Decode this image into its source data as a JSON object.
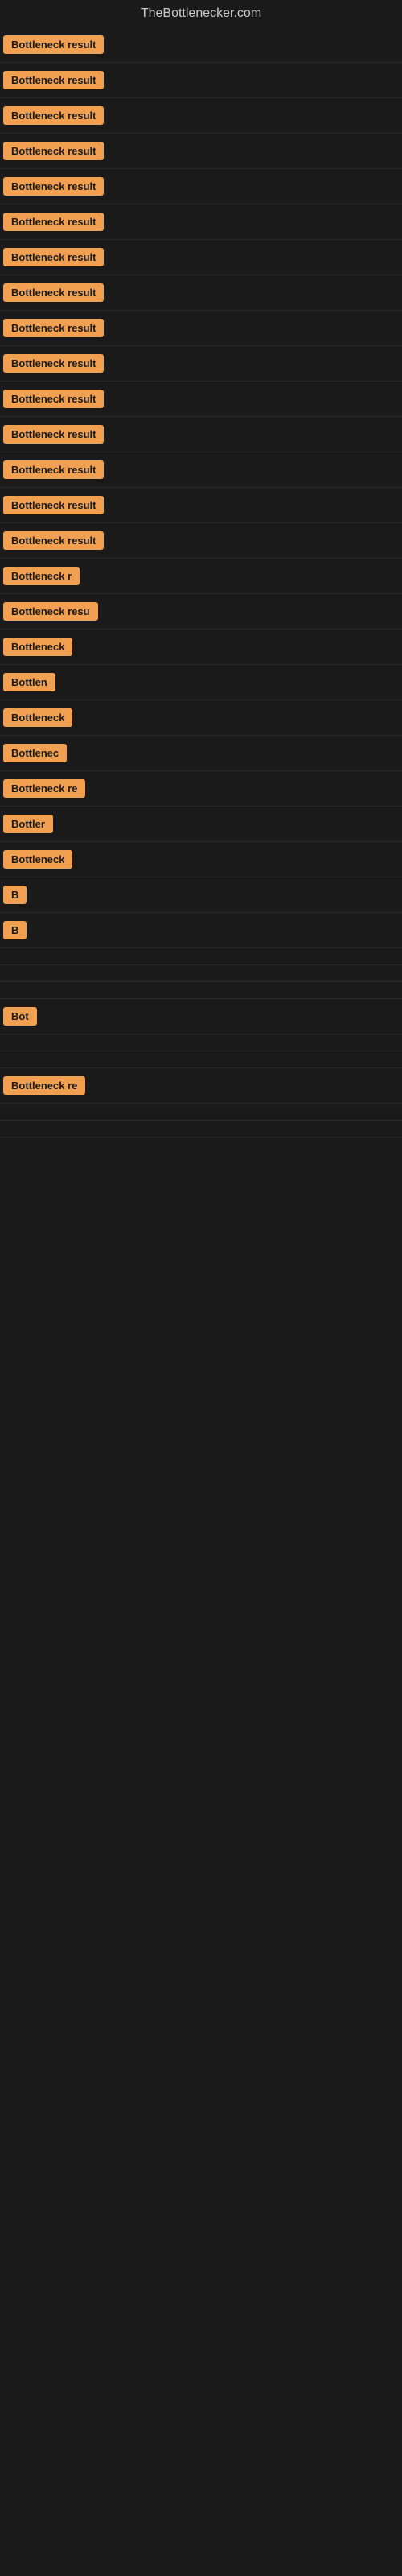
{
  "header": {
    "title": "TheBottlenecker.com"
  },
  "results": [
    {
      "label": "Bottleneck result",
      "width": 130
    },
    {
      "label": "Bottleneck result",
      "width": 130
    },
    {
      "label": "Bottleneck result",
      "width": 130
    },
    {
      "label": "Bottleneck result",
      "width": 130
    },
    {
      "label": "Bottleneck result",
      "width": 130
    },
    {
      "label": "Bottleneck result",
      "width": 130
    },
    {
      "label": "Bottleneck result",
      "width": 130
    },
    {
      "label": "Bottleneck result",
      "width": 130
    },
    {
      "label": "Bottleneck result",
      "width": 130
    },
    {
      "label": "Bottleneck result",
      "width": 130
    },
    {
      "label": "Bottleneck result",
      "width": 130
    },
    {
      "label": "Bottleneck result",
      "width": 130
    },
    {
      "label": "Bottleneck result",
      "width": 130
    },
    {
      "label": "Bottleneck result",
      "width": 130
    },
    {
      "label": "Bottleneck result",
      "width": 130
    },
    {
      "label": "Bottleneck r",
      "width": 90
    },
    {
      "label": "Bottleneck resu",
      "width": 105
    },
    {
      "label": "Bottleneck",
      "width": 78
    },
    {
      "label": "Bottlen",
      "width": 62
    },
    {
      "label": "Bottleneck",
      "width": 78
    },
    {
      "label": "Bottlenec",
      "width": 70
    },
    {
      "label": "Bottleneck re",
      "width": 95
    },
    {
      "label": "Bottler",
      "width": 52
    },
    {
      "label": "Bottleneck",
      "width": 78
    },
    {
      "label": "B",
      "width": 18
    },
    {
      "label": "B",
      "width": 10
    },
    {
      "label": "",
      "width": 0
    },
    {
      "label": "",
      "width": 0
    },
    {
      "label": "",
      "width": 6
    },
    {
      "label": "Bot",
      "width": 26
    },
    {
      "label": "",
      "width": 0
    },
    {
      "label": "",
      "width": 0
    },
    {
      "label": "Bottleneck re",
      "width": 95
    },
    {
      "label": "",
      "width": 0
    },
    {
      "label": "",
      "width": 0
    }
  ]
}
